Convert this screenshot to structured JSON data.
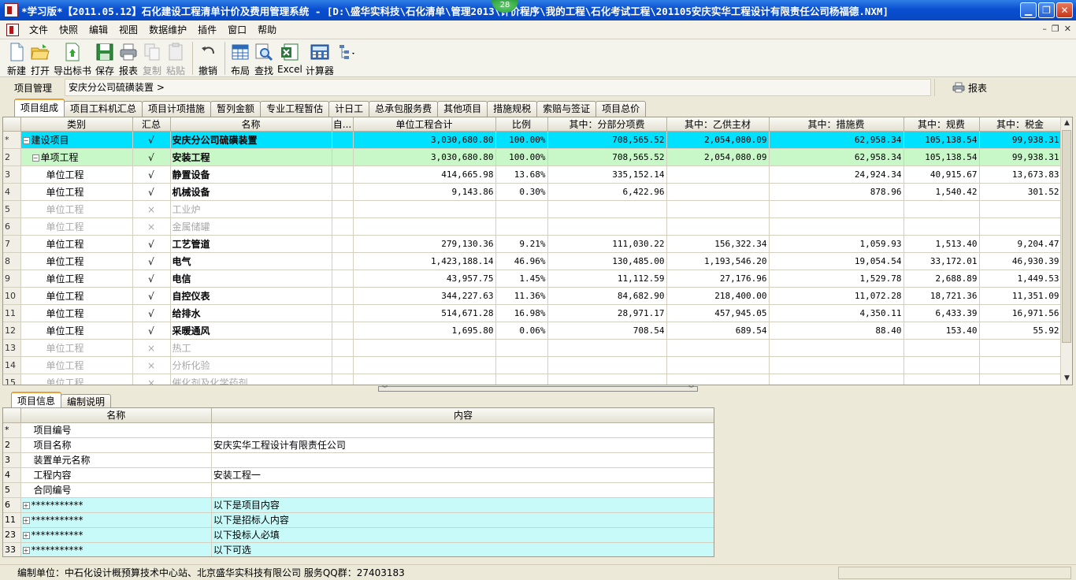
{
  "window": {
    "title": "*学习版*【2011.05.12】石化建设工程清单计价及费用管理系统 - [D:\\盛华实科技\\石化清单\\管理2013\\计价程序\\我的工程\\石化考试工程\\201105安庆实华工程设计有限责任公司杨福德.NXM]",
    "badge": "28",
    "buttons": {
      "minimize": "▁",
      "restore": "❐",
      "close": "✕"
    }
  },
  "menu": {
    "items": [
      "文件",
      "快照",
      "编辑",
      "视图",
      "数据维护",
      "插件",
      "窗口",
      "帮助"
    ],
    "mdi": {
      "minimize": "–",
      "restore": "❐",
      "close": "✕"
    }
  },
  "toolbar": {
    "new": "新建",
    "open": "打开",
    "export": "导出标书",
    "save": "保存",
    "report": "报表",
    "copy": "复制",
    "paste": "粘贴",
    "undo": "撤销",
    "layout": "布局",
    "find": "查找",
    "excel": "Excel",
    "calculator": "计算器"
  },
  "pathbar": {
    "label": "项目管理",
    "breadcrumb": "安庆分公司硫磺装置  >",
    "report": "报表"
  },
  "tabs": [
    "项目组成",
    "项目工料机汇总",
    "项目计项措施",
    "暂列金额",
    "专业工程暂估",
    "计日工",
    "总承包服务费",
    "其他项目",
    "措施规税",
    "索赔与签证",
    "项目总价"
  ],
  "grid": {
    "columns": [
      "类别",
      "汇总",
      "名称",
      "自...",
      "单位工程合计",
      "比例",
      "其中：分部分项费",
      "其中：乙供主材",
      "其中：措施费",
      "其中：规费",
      "其中：税金"
    ],
    "rows": [
      {
        "rn": "*",
        "cat": "建设项目",
        "chk": "√",
        "name": "安庆分公司硫磺装置",
        "total": "3,030,680.80",
        "ratio": "100.00%",
        "sub": "708,565.52",
        "mat": "2,054,080.09",
        "meas": "62,958.34",
        "fee": "105,138.54",
        "tax": "99,938.31"
      },
      {
        "rn": "2",
        "cat": "单项工程",
        "chk": "√",
        "name": "安装工程",
        "total": "3,030,680.80",
        "ratio": "100.00%",
        "sub": "708,565.52",
        "mat": "2,054,080.09",
        "meas": "62,958.34",
        "fee": "105,138.54",
        "tax": "99,938.31"
      },
      {
        "rn": "3",
        "cat": "单位工程",
        "chk": "√",
        "name": "静置设备",
        "total": "414,665.98",
        "ratio": "13.68%",
        "sub": "335,152.14",
        "mat": "",
        "meas": "24,924.34",
        "fee": "40,915.67",
        "tax": "13,673.83"
      },
      {
        "rn": "4",
        "cat": "单位工程",
        "chk": "√",
        "name": "机械设备",
        "total": "9,143.86",
        "ratio": "0.30%",
        "sub": "6,422.96",
        "mat": "",
        "meas": "878.96",
        "fee": "1,540.42",
        "tax": "301.52"
      },
      {
        "rn": "5",
        "cat": "单位工程",
        "chk": "×",
        "name": "工业炉",
        "total": "",
        "ratio": "",
        "sub": "",
        "mat": "",
        "meas": "",
        "fee": "",
        "tax": ""
      },
      {
        "rn": "6",
        "cat": "单位工程",
        "chk": "×",
        "name": "金属储罐",
        "total": "",
        "ratio": "",
        "sub": "",
        "mat": "",
        "meas": "",
        "fee": "",
        "tax": ""
      },
      {
        "rn": "7",
        "cat": "单位工程",
        "chk": "√",
        "name": "工艺管道",
        "total": "279,130.36",
        "ratio": "9.21%",
        "sub": "111,030.22",
        "mat": "156,322.34",
        "meas": "1,059.93",
        "fee": "1,513.40",
        "tax": "9,204.47"
      },
      {
        "rn": "8",
        "cat": "单位工程",
        "chk": "√",
        "name": "电气",
        "total": "1,423,188.14",
        "ratio": "46.96%",
        "sub": "130,485.00",
        "mat": "1,193,546.20",
        "meas": "19,054.54",
        "fee": "33,172.01",
        "tax": "46,930.39"
      },
      {
        "rn": "9",
        "cat": "单位工程",
        "chk": "√",
        "name": "电信",
        "total": "43,957.75",
        "ratio": "1.45%",
        "sub": "11,112.59",
        "mat": "27,176.96",
        "meas": "1,529.78",
        "fee": "2,688.89",
        "tax": "1,449.53"
      },
      {
        "rn": "10",
        "cat": "单位工程",
        "chk": "√",
        "name": "自控仪表",
        "total": "344,227.63",
        "ratio": "11.36%",
        "sub": "84,682.90",
        "mat": "218,400.00",
        "meas": "11,072.28",
        "fee": "18,721.36",
        "tax": "11,351.09"
      },
      {
        "rn": "11",
        "cat": "单位工程",
        "chk": "√",
        "name": "给排水",
        "total": "514,671.28",
        "ratio": "16.98%",
        "sub": "28,971.17",
        "mat": "457,945.05",
        "meas": "4,350.11",
        "fee": "6,433.39",
        "tax": "16,971.56"
      },
      {
        "rn": "12",
        "cat": "单位工程",
        "chk": "√",
        "name": "采暖通风",
        "total": "1,695.80",
        "ratio": "0.06%",
        "sub": "708.54",
        "mat": "689.54",
        "meas": "88.40",
        "fee": "153.40",
        "tax": "55.92"
      },
      {
        "rn": "13",
        "cat": "单位工程",
        "chk": "×",
        "name": "热工",
        "total": "",
        "ratio": "",
        "sub": "",
        "mat": "",
        "meas": "",
        "fee": "",
        "tax": ""
      },
      {
        "rn": "14",
        "cat": "单位工程",
        "chk": "×",
        "name": "分析化验",
        "total": "",
        "ratio": "",
        "sub": "",
        "mat": "",
        "meas": "",
        "fee": "",
        "tax": ""
      },
      {
        "rn": "15",
        "cat": "单位工程",
        "chk": "×",
        "name": "催化剂及化学药剂",
        "total": "",
        "ratio": "",
        "sub": "",
        "mat": "",
        "meas": "",
        "fee": "",
        "tax": ""
      }
    ]
  },
  "bottom_tabs": [
    "项目信息",
    "编制说明"
  ],
  "info": {
    "columns": [
      "名称",
      "内容"
    ],
    "rows": [
      {
        "rn": "*",
        "name": "项目编号",
        "content": "",
        "group": false
      },
      {
        "rn": "2",
        "name": "项目名称",
        "content": "安庆实华工程设计有限责任公司",
        "group": false
      },
      {
        "rn": "3",
        "name": "装置单元名称",
        "content": "",
        "group": false
      },
      {
        "rn": "4",
        "name": "工程内容",
        "content": "安装工程一",
        "group": false
      },
      {
        "rn": "5",
        "name": "合同编号",
        "content": "",
        "group": false
      },
      {
        "rn": "6",
        "name": "***********",
        "content": "以下是项目内容",
        "group": true
      },
      {
        "rn": "11",
        "name": "***********",
        "content": "以下是招标人内容",
        "group": true
      },
      {
        "rn": "23",
        "name": "***********",
        "content": "以下投标人必填",
        "group": true
      },
      {
        "rn": "33",
        "name": "***********",
        "content": "以下可选",
        "group": true
      }
    ]
  },
  "status": {
    "text": "编制单位：中石化设计概预算技术中心站、北京盛华实科技有限公司 服务QQ群：27403183"
  },
  "colors": {
    "title_bar": "#0a4fd0",
    "top_row": "#00e0ff",
    "sub_row": "#c8f7c8",
    "group_row": "#c8fafa",
    "active_tab": "#e7a13a"
  }
}
